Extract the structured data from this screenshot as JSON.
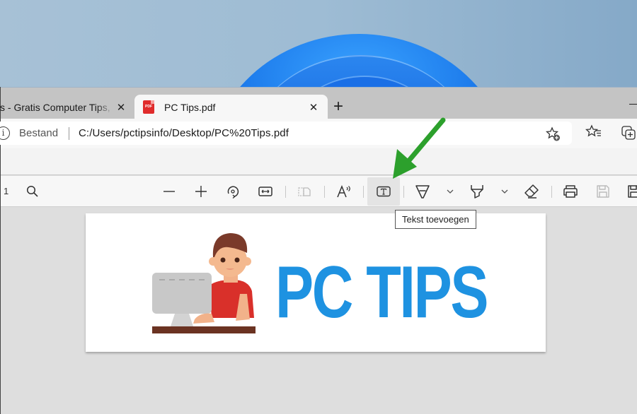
{
  "browser": {
    "tabs": [
      {
        "title": "s - Gratis Computer Tips, i",
        "active": false
      },
      {
        "title": "PC Tips.pdf",
        "active": true
      }
    ],
    "new_tab_label": "+",
    "close_label": "✕",
    "address": {
      "scheme_label": "Bestand",
      "url": "C:/Users/pctipsinfo/Desktop/PC%20Tips.pdf"
    }
  },
  "pdf_toolbar": {
    "page_indicator": "1",
    "buttons": [
      {
        "id": "search",
        "label": "Zoeken"
      },
      {
        "id": "zoom-out"
      },
      {
        "id": "zoom-in"
      },
      {
        "id": "rotate"
      },
      {
        "id": "fit-width"
      },
      {
        "id": "page-view"
      },
      {
        "id": "read-aloud"
      },
      {
        "id": "add-text",
        "active": true
      },
      {
        "id": "draw"
      },
      {
        "id": "highlight"
      },
      {
        "id": "erase"
      },
      {
        "id": "print"
      },
      {
        "id": "save"
      },
      {
        "id": "save-as"
      }
    ],
    "tooltip": "Tekst toevoegen"
  },
  "document": {
    "logo_text": "PC TIPS"
  },
  "annotation": {
    "arrow_color": "#2ca02c"
  },
  "colors": {
    "logo_blue": "#1e92e1",
    "shirt_red": "#d9302a",
    "hair_brown": "#7a3a2a",
    "desk_brown": "#6b3322",
    "monitor_gray": "#c8c8c8"
  }
}
